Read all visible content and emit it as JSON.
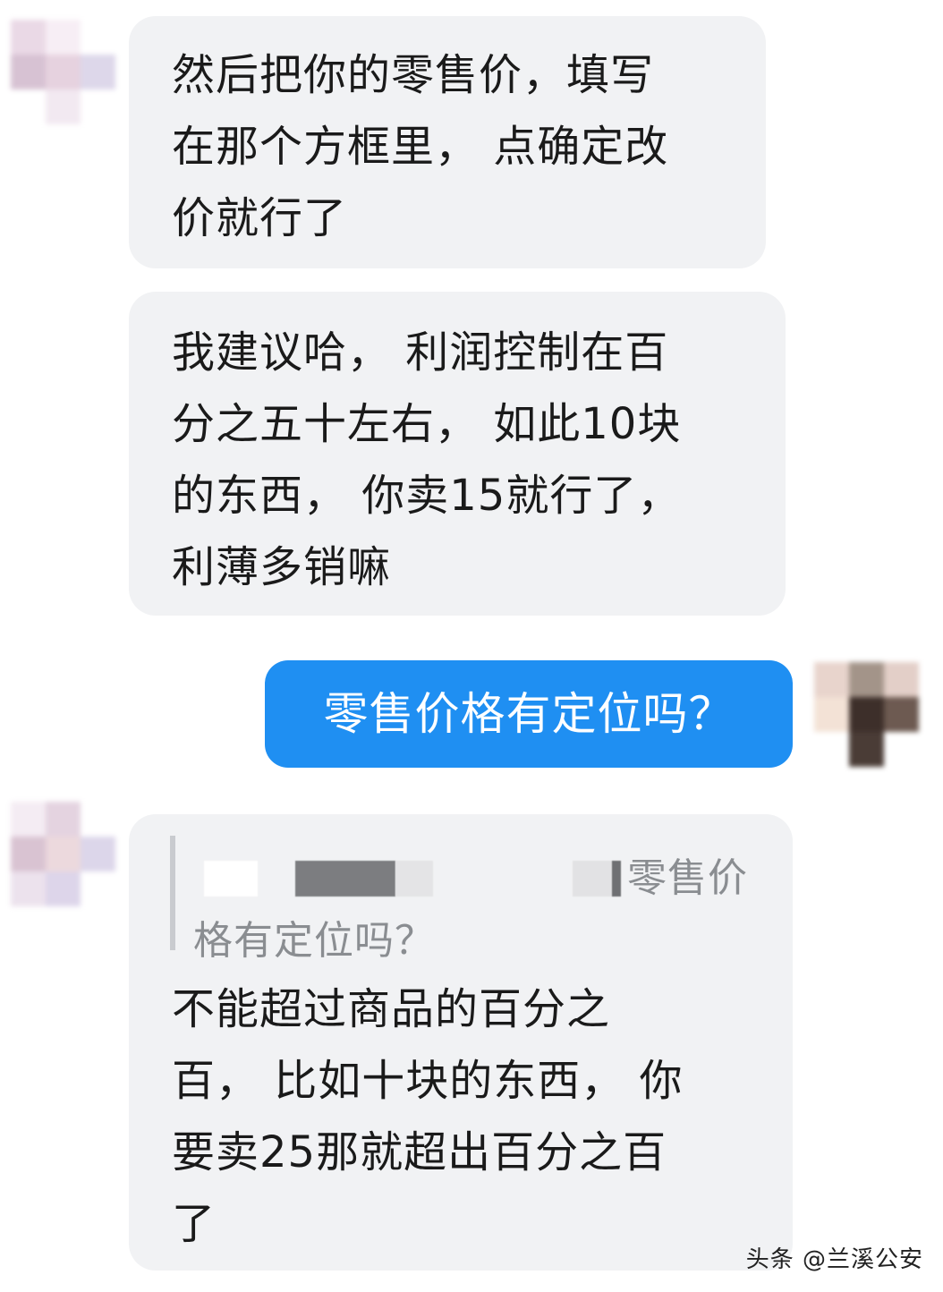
{
  "messages": [
    {
      "side": "incoming",
      "lines": [
        "然后把你的零售价，填写",
        "在那个方框里， 点确定改",
        "价就行了"
      ]
    },
    {
      "side": "incoming",
      "lines": [
        "我建议哈， 利润控制在百",
        "分之五十左右， 如此10块",
        "的东西， 你卖15就行了，",
        "利薄多销嘛"
      ]
    },
    {
      "side": "outgoing",
      "text": "零售价格有定位吗？"
    },
    {
      "side": "incoming",
      "quote": {
        "line1": "零售价",
        "line2": "格有定位吗？"
      },
      "lines": [
        "不能超过商品的百分之",
        "百， 比如十块的东西， 你",
        "要卖25那就超出百分之百",
        "了"
      ]
    }
  ],
  "watermark": "头条 @兰溪公安",
  "colors": {
    "incoming_bubble": "#f1f2f4",
    "outgoing_bubble": "#1f8ff2",
    "quote_text": "#8a8d91"
  }
}
